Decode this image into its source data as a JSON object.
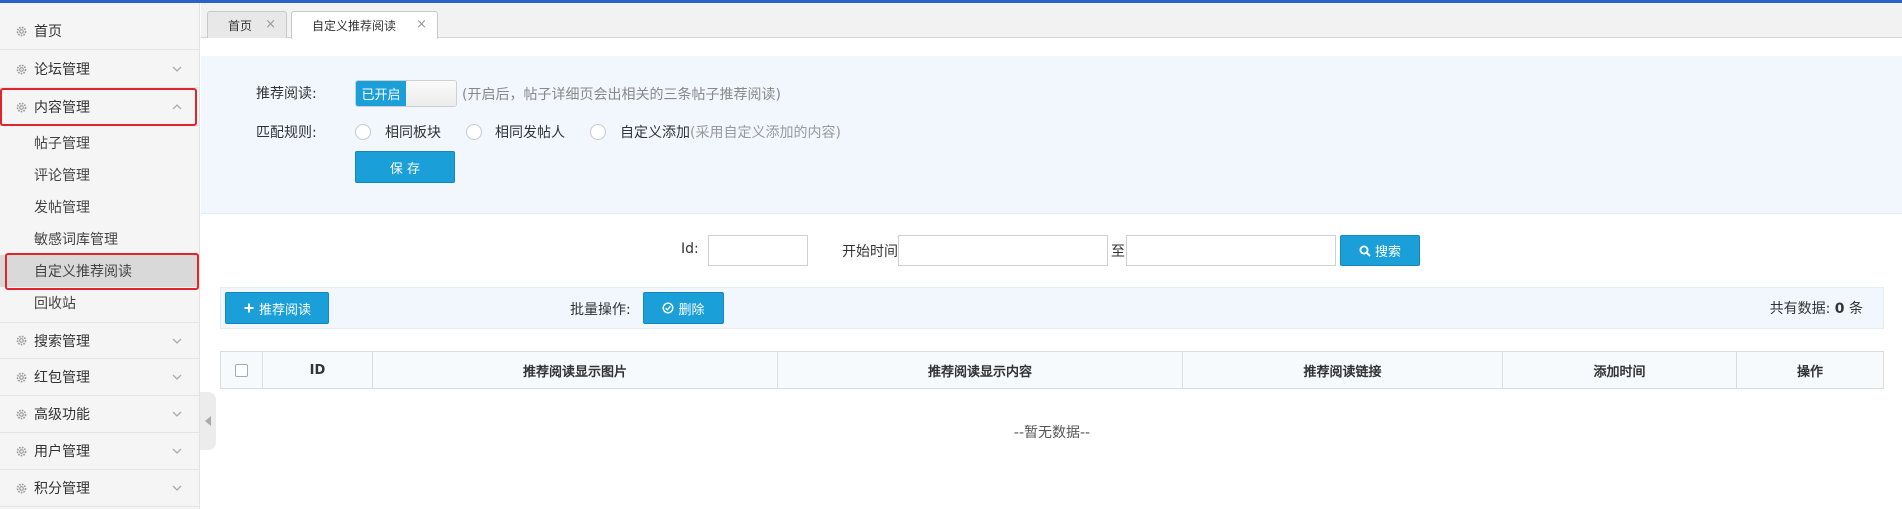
{
  "sidebar": {
    "menu": [
      {
        "label": "首页",
        "icon": "gear-icon",
        "has_chevron": false
      },
      {
        "label": "论坛管理",
        "icon": "gear-icon",
        "has_chevron": true
      },
      {
        "label": "内容管理",
        "icon": "gear-icon",
        "has_chevron": true,
        "expanded": true
      },
      {
        "label": "搜索管理",
        "icon": "gear-icon",
        "has_chevron": true
      },
      {
        "label": "红包管理",
        "icon": "gear-icon",
        "has_chevron": true
      },
      {
        "label": "高级功能",
        "icon": "gear-icon",
        "has_chevron": true
      },
      {
        "label": "用户管理",
        "icon": "gear-icon",
        "has_chevron": true
      },
      {
        "label": "积分管理",
        "icon": "gear-icon",
        "has_chevron": true
      }
    ],
    "sub_items": [
      {
        "label": "帖子管理"
      },
      {
        "label": "评论管理"
      },
      {
        "label": "发帖管理"
      },
      {
        "label": "敏感词库管理"
      },
      {
        "label": "自定义推荐阅读",
        "active": true
      },
      {
        "label": "回收站"
      }
    ]
  },
  "tabs": [
    {
      "label": "首页",
      "close": "×",
      "active": false
    },
    {
      "label": "自定义推荐阅读",
      "close": "×",
      "active": true
    }
  ],
  "settings": {
    "recommend_label": "推荐阅读:",
    "switch_on_label": "已开启",
    "switch_hint": "(开启后，帖子详细页会出相关的三条帖子推荐阅读)",
    "match_label": "匹配规则:",
    "options": [
      {
        "label": "相同板块",
        "hint": ""
      },
      {
        "label": "相同发帖人",
        "hint": ""
      },
      {
        "label": "自定义添加",
        "hint": "(采用自定义添加的内容)"
      }
    ],
    "save_label": "保 存"
  },
  "search": {
    "id_label": "Id:",
    "id_value": "",
    "start_label": "开始时间",
    "start_value": "",
    "to_label": "至",
    "end_value": "",
    "search_label": "搜索"
  },
  "actions": {
    "add_label": "推荐阅读",
    "batch_label": "批量操作:",
    "delete_label": "删除",
    "total_prefix": "共有数据:",
    "total_count": "0",
    "total_suffix": "条"
  },
  "table": {
    "columns": [
      "",
      "ID",
      "推荐阅读显示图片",
      "推荐阅读显示内容",
      "推荐阅读链接",
      "添加时间",
      "操作"
    ],
    "empty_text": "--暂无数据--"
  },
  "colors": {
    "accent": "#1b9fd8",
    "highlight_border": "#e0242b",
    "top_line": "#2b62c9"
  }
}
